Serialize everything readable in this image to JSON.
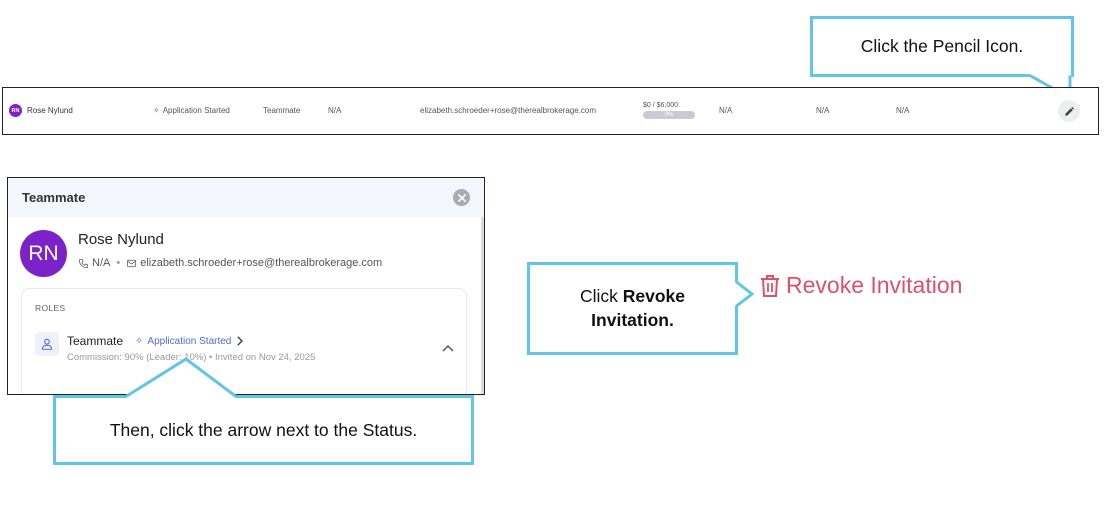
{
  "callouts": {
    "pencil": "Click the Pencil Icon.",
    "revoke_prefix": "Click ",
    "revoke_bold_1": "Revoke",
    "revoke_bold_2": "Invitation.",
    "arrow": "Then, click the arrow next to the Status."
  },
  "row": {
    "initials": "RN",
    "name": "Rose Nylund",
    "status": "Application Started",
    "role": "Teammate",
    "phone": "N/A",
    "email": "elizabeth.schroeder+rose@therealbrokerage.com",
    "amount": "$0 / $6,000",
    "progress_label": "0%",
    "progress": 0,
    "col_a": "N/A",
    "col_b": "N/A",
    "col_c": "N/A"
  },
  "panel": {
    "title": "Teammate",
    "initials": "RN",
    "name": "Rose Nylund",
    "phone": "N/A",
    "email": "elizabeth.schroeder+rose@therealbrokerage.com",
    "roles_label": "ROLES",
    "role_name": "Teammate",
    "role_status": "Application Started",
    "role_sub": "Commission: 90% (Leader: 10%)  •  Invited on Nov 24, 2025"
  },
  "revoke_label": "Revoke Invitation",
  "colors": {
    "accent": "#5fc6ea",
    "avatar": "#7b22c9",
    "status": "#4f6bd8",
    "danger": "#e0506b"
  },
  "icons": [
    "pencil-icon",
    "close-icon",
    "phone-icon",
    "mail-icon",
    "user-icon",
    "sparkle-icon",
    "chevron-right-icon",
    "chevron-up-icon",
    "trash-icon"
  ]
}
